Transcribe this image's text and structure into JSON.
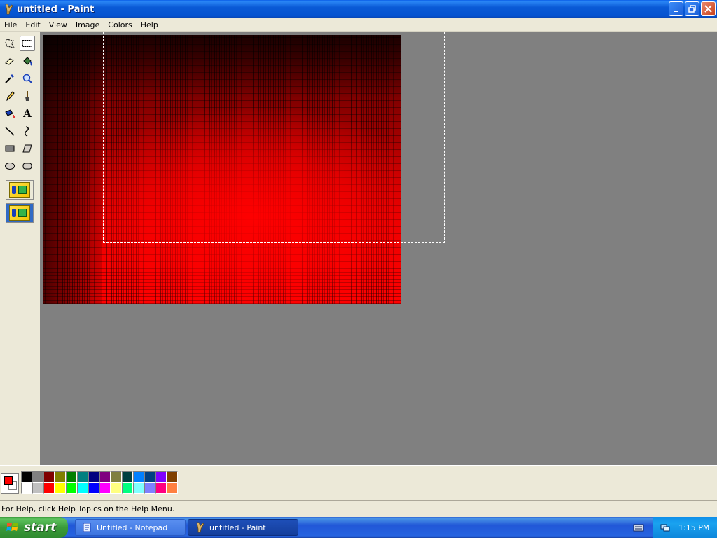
{
  "window": {
    "title": "untitled - Paint",
    "controls": [
      "minimize",
      "maximize",
      "close"
    ]
  },
  "menu": [
    "File",
    "Edit",
    "View",
    "Image",
    "Colors",
    "Help"
  ],
  "tools": [
    {
      "name": "free-form-select",
      "icon": "free-form-select-icon"
    },
    {
      "name": "select",
      "icon": "rectangle-select-icon",
      "selected": true
    },
    {
      "name": "eraser",
      "icon": "eraser-icon"
    },
    {
      "name": "fill",
      "icon": "fill-bucket-icon"
    },
    {
      "name": "pick-color",
      "icon": "eyedropper-icon"
    },
    {
      "name": "magnifier",
      "icon": "magnifier-icon"
    },
    {
      "name": "pencil",
      "icon": "pencil-icon"
    },
    {
      "name": "brush",
      "icon": "brush-icon"
    },
    {
      "name": "airbrush",
      "icon": "airbrush-icon"
    },
    {
      "name": "text",
      "icon": "text-icon",
      "glyph": "A"
    },
    {
      "name": "line",
      "icon": "line-icon"
    },
    {
      "name": "curve",
      "icon": "curve-icon"
    },
    {
      "name": "rectangle",
      "icon": "rectangle-icon"
    },
    {
      "name": "polygon",
      "icon": "polygon-icon"
    },
    {
      "name": "ellipse",
      "icon": "ellipse-icon"
    },
    {
      "name": "rounded-rectangle",
      "icon": "rounded-rectangle-icon"
    }
  ],
  "colors": {
    "foreground": "#ff0000",
    "background": "#ffffff",
    "palette": [
      "#000000",
      "#808080",
      "#800000",
      "#808000",
      "#008000",
      "#008080",
      "#000080",
      "#800080",
      "#808040",
      "#004040",
      "#0080ff",
      "#004080",
      "#8000ff",
      "#804000",
      "#ffffff",
      "#c0c0c0",
      "#ff0000",
      "#ffff00",
      "#00ff00",
      "#00ffff",
      "#0000ff",
      "#ff00ff",
      "#ffff80",
      "#00ff80",
      "#80ffff",
      "#8080ff",
      "#ff0080",
      "#ff8040"
    ]
  },
  "status": {
    "help_text": "For Help, click Help Topics on the Help Menu."
  },
  "taskbar": {
    "start_label": "start",
    "tasks": [
      {
        "label": "Untitled - Notepad",
        "icon": "notepad-icon"
      },
      {
        "label": "untitled - Paint",
        "icon": "paint-icon",
        "active": true
      }
    ],
    "clock": "1:15 PM"
  }
}
